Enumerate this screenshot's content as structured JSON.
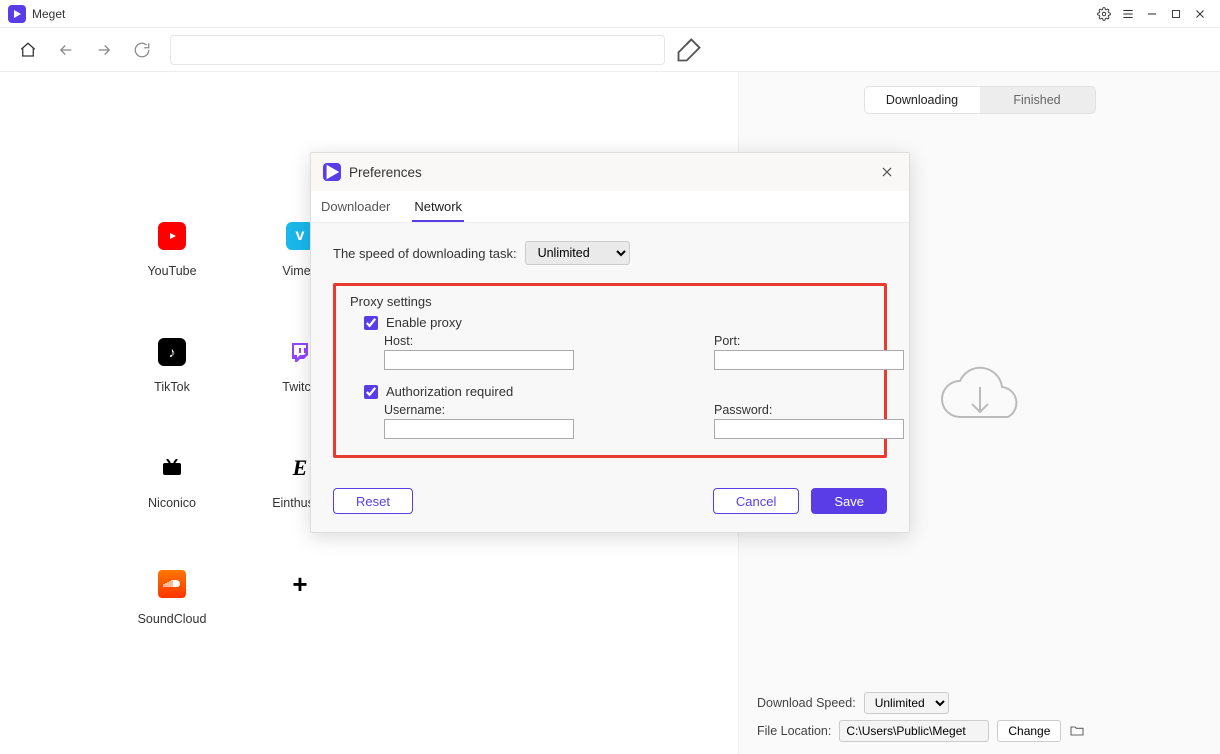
{
  "app": {
    "name": "Meget"
  },
  "toolbar": {
    "url_value": ""
  },
  "sites": [
    {
      "label": "YouTube"
    },
    {
      "label": "Vimeo"
    },
    {
      "label": "TikTok"
    },
    {
      "label": "Twitch"
    },
    {
      "label": "Niconico"
    },
    {
      "label": "Einthusan"
    },
    {
      "label": "SoundCloud"
    },
    {
      "label": ""
    }
  ],
  "right": {
    "tabs": {
      "downloading": "Downloading",
      "finished": "Finished"
    },
    "footer": {
      "speed_label": "Download Speed:",
      "speed_value": "Unlimited",
      "location_label": "File Location:",
      "location_value": "C:\\Users\\Public\\Meget",
      "change_label": "Change"
    }
  },
  "prefs": {
    "title": "Preferences",
    "tabs": {
      "downloader": "Downloader",
      "network": "Network"
    },
    "speed_label": "The speed of downloading task:",
    "speed_value": "Unlimited",
    "proxy_title": "Proxy settings",
    "enable_proxy_label": "Enable proxy",
    "enable_proxy_checked": true,
    "host_label": "Host:",
    "host_value": "",
    "port_label": "Port:",
    "port_value": "",
    "auth_label": "Authorization required",
    "auth_checked": true,
    "user_label": "Username:",
    "user_value": "",
    "pass_label": "Password:",
    "pass_value": "",
    "reset_label": "Reset",
    "cancel_label": "Cancel",
    "save_label": "Save"
  }
}
